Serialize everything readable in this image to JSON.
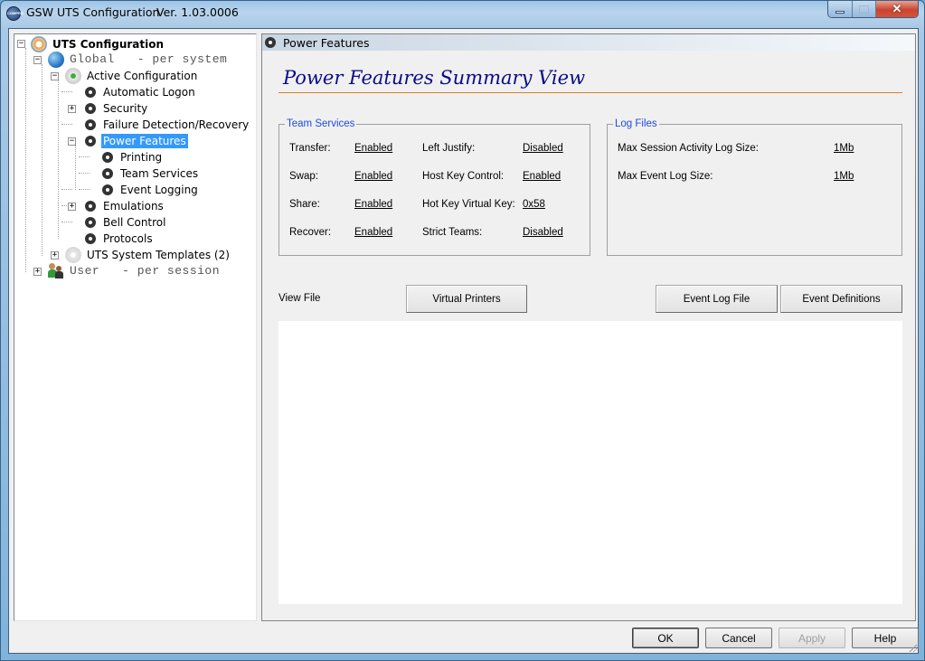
{
  "window": {
    "app_icon_label": "COMPRO",
    "title": "GSW UTS Configuration",
    "version": "Ver. 1.03.0006",
    "controls": {
      "minimize": "minimize",
      "maximize": "maximize",
      "close": "✕"
    }
  },
  "tree": {
    "items": [
      {
        "label": "UTS Configuration",
        "icon": "config-icon",
        "expanded": true,
        "level": 0
      },
      {
        "label": "Global   - per system",
        "icon": "globe-icon",
        "expanded": true,
        "level": 1
      },
      {
        "label": "Active Configuration",
        "icon": "active-config-icon",
        "expanded": true,
        "level": 2
      },
      {
        "label": "Automatic Logon",
        "icon": "gear-icon",
        "level": 3
      },
      {
        "label": "Security",
        "icon": "gear-icon",
        "expandable": true,
        "level": 3
      },
      {
        "label": "Failure Detection/Recovery",
        "icon": "gear-icon",
        "level": 3
      },
      {
        "label": "Power Features",
        "icon": "gear-icon",
        "expanded": true,
        "selected": true,
        "level": 3
      },
      {
        "label": "Printing",
        "icon": "gear-icon",
        "level": 4
      },
      {
        "label": "Team Services",
        "icon": "gear-icon",
        "level": 4
      },
      {
        "label": "Event Logging",
        "icon": "gear-icon",
        "level": 4
      },
      {
        "label": "Emulations",
        "icon": "gear-icon",
        "expandable": true,
        "level": 3
      },
      {
        "label": "Bell Control",
        "icon": "gear-icon",
        "level": 3
      },
      {
        "label": "Protocols",
        "icon": "gear-icon",
        "level": 3
      },
      {
        "label": "UTS System Templates (2)",
        "icon": "template-icon",
        "expandable": true,
        "level": 2
      },
      {
        "label": "User   - per session",
        "icon": "users-icon",
        "expandable": true,
        "level": 1
      }
    ]
  },
  "panel": {
    "header": "Power Features",
    "summary_title": "Power Features Summary View",
    "team_services": {
      "legend": "Team Services",
      "rows": [
        {
          "label": "Transfer:",
          "value": "Enabled",
          "label2": "Left Justify:",
          "value2": "Disabled"
        },
        {
          "label": "Swap:",
          "value": "Enabled",
          "label2": "Host Key Control:",
          "value2": "Enabled"
        },
        {
          "label": "Share:",
          "value": "Enabled",
          "label2": "Hot Key Virtual Key:",
          "value2": "0x58"
        },
        {
          "label": "Recover:",
          "value": "Enabled",
          "label2": "Strict Teams:",
          "value2": "Disabled"
        }
      ]
    },
    "log_files": {
      "legend": "Log Files",
      "rows": [
        {
          "label": "Max Session Activity Log Size:",
          "value": "1Mb"
        },
        {
          "label": "Max Event Log Size:",
          "value": "1Mb"
        }
      ]
    },
    "view_file_label": "View File",
    "buttons": {
      "virtual_printers": "Virtual Printers",
      "event_log_file": "Event Log File",
      "event_definitions": "Event Definitions"
    },
    "file_content": ""
  },
  "dialog_buttons": {
    "ok": "OK",
    "cancel": "Cancel",
    "apply": "Apply",
    "help": "Help"
  },
  "colors": {
    "selection": "#3399ff",
    "summary_title": "#0a0a8a",
    "summary_rule": "#e07c1e",
    "group_legend": "#1d4ce0"
  }
}
